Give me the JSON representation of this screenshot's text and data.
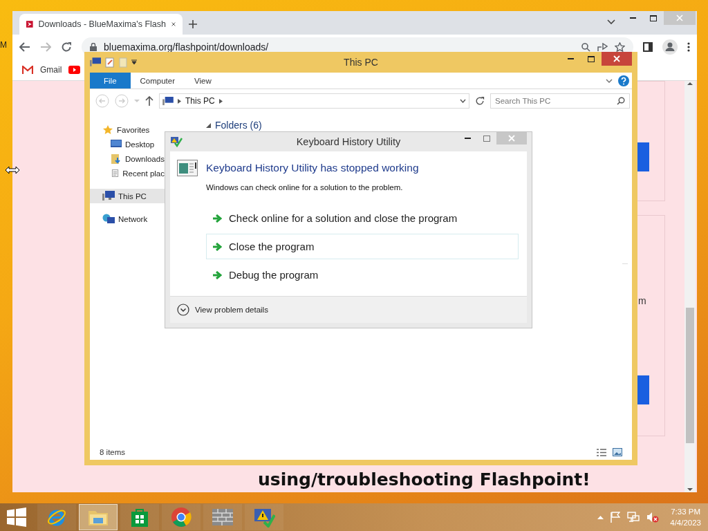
{
  "desktop": {
    "edge_text": "M"
  },
  "browser": {
    "tab": {
      "title": "Downloads - BlueMaxima's Flash"
    },
    "url": "bluemaxima.org/flashpoint/downloads/",
    "bookmarks": [
      {
        "label": "Gmail",
        "kind": "gmail"
      },
      {
        "kind": "youtube"
      }
    ],
    "page": {
      "fragment": "m",
      "heading": "using/troubleshooting Flashpoint!"
    }
  },
  "explorer": {
    "title": "This PC",
    "ribbon_tabs": [
      {
        "label": "File",
        "selected": true
      },
      {
        "label": "Computer",
        "selected": false
      },
      {
        "label": "View",
        "selected": false
      }
    ],
    "breadcrumb": "This PC",
    "search": {
      "placeholder": "Search This PC"
    },
    "nav": [
      {
        "label": "Favorites",
        "kind": "star",
        "selected": false,
        "children": [
          {
            "label": "Desktop",
            "kind": "desktop",
            "selected": false
          },
          {
            "label": "Downloads",
            "kind": "downloads",
            "selected": false
          },
          {
            "label": "Recent plac",
            "kind": "recent",
            "selected": false
          }
        ]
      },
      {
        "label": "This PC",
        "kind": "pc",
        "selected": true
      },
      {
        "label": "Network",
        "kind": "network",
        "selected": false
      }
    ],
    "group_header": "Folders (6)",
    "status": "8 items"
  },
  "dialog": {
    "title": "Keyboard History Utility",
    "heading": "Keyboard History Utility has stopped working",
    "message": "Windows can check online for a solution to the problem.",
    "options": [
      {
        "label": "Check online for a solution and close the program",
        "selected": false
      },
      {
        "label": "Close the program",
        "selected": true
      },
      {
        "label": "Debug the program",
        "selected": false
      }
    ],
    "details": "View problem details"
  },
  "taskbar": {
    "apps": [
      {
        "kind": "ie",
        "active": false
      },
      {
        "kind": "explorer",
        "active": true
      },
      {
        "kind": "store",
        "active": false
      },
      {
        "kind": "chrome",
        "active": false
      },
      {
        "kind": "firewall",
        "active": false
      },
      {
        "kind": "action-center",
        "active": false
      }
    ],
    "time": "7:33 PM",
    "date": "4/4/2023"
  }
}
